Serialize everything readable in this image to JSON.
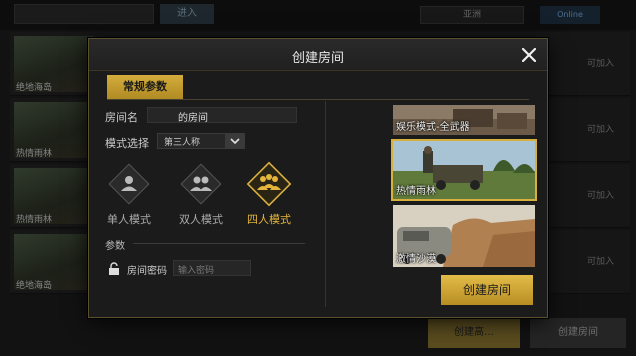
{
  "background": {
    "search_placeholder": "",
    "enter_label": "进入",
    "region_label": "亚洲",
    "online_label": "Online",
    "rooms": [
      {
        "map": "绝地海岛",
        "status": "可加入"
      },
      {
        "map": "热情雨林",
        "status": "可加入"
      },
      {
        "map": "热情雨林",
        "status": "可加入"
      },
      {
        "map": "绝地海岛",
        "status": "可加入"
      }
    ],
    "bottom_create": "创建高…",
    "bottom_create_room": "创建房间"
  },
  "dialog": {
    "title": "创建房间",
    "tab_general": "常规参数",
    "room_name_label": "房间名",
    "room_name_value": "的房间",
    "mode_label": "模式选择",
    "mode_value": "第三人称",
    "squads": [
      {
        "label": "单人模式",
        "active": false
      },
      {
        "label": "双人模式",
        "active": false
      },
      {
        "label": "四人模式",
        "active": true
      }
    ],
    "params_label": "参数",
    "password_label": "房间密码",
    "password_placeholder": "输入密码",
    "maps": [
      {
        "name": "娱乐模式-全武器",
        "selected": false
      },
      {
        "name": "热情雨林",
        "selected": true
      },
      {
        "name": "激情沙漠",
        "selected": false
      }
    ],
    "create_button": "创建房间"
  },
  "colors": {
    "accent_gold": "#d4ad3c",
    "panel_bg": "#1b1b1b"
  },
  "icons": {
    "close": "close-icon",
    "dropdown": "chevron-down-icon",
    "lock": "lock-icon"
  }
}
